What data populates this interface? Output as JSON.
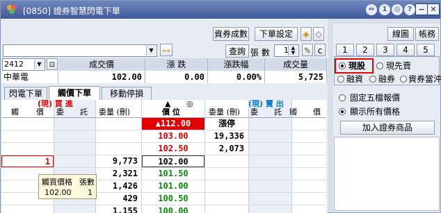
{
  "window": {
    "title": "[0850] 證券智慧閃電下單"
  },
  "titlebar_icons": [
    "nav-icon",
    "help-icon",
    "question-icon"
  ],
  "toolbar": {
    "btn_trade_result": "資券成數",
    "btn_order_setting": "下單設定",
    "btn_query": "查詢",
    "qty_label": "張 數",
    "qty_value": "1",
    "btn_chart": "線圖",
    "btn_account": "帳務",
    "num_buttons": [
      "1",
      "2",
      "3",
      "4",
      "5"
    ]
  },
  "stock": {
    "code": "2412",
    "name": "中華電",
    "headers": [
      "成交價",
      "漲 跌",
      "漲跌幅",
      "成交量"
    ],
    "values": [
      "102.00",
      "0.00",
      "0.00%",
      "5,725"
    ]
  },
  "tabs": [
    "閃電下單",
    "觸價下單",
    "移動停損"
  ],
  "grid": {
    "buy_title": "(現) 買 進",
    "sell_title": "(現) 賣 出",
    "mid_symbols": [
      "▲",
      "◎"
    ],
    "headers": {
      "left": [
        "觸",
        "價",
        "委",
        "託",
        "委量 (刪)"
      ],
      "mid": "價 位",
      "right": [
        "委量 (刪)",
        "委",
        "託",
        "觸",
        "價"
      ]
    },
    "rows": [
      {
        "trigger_buy": "",
        "buy_qty": "",
        "price": "▲112.00",
        "sell_qty": "漲停"
      },
      {
        "trigger_buy": "",
        "buy_qty": "",
        "price": "103.00",
        "sell_qty": "19,336"
      },
      {
        "trigger_buy": "",
        "buy_qty": "",
        "price": "102.50",
        "sell_qty": "2,073"
      },
      {
        "trigger_buy": "1",
        "buy_qty": "9,773",
        "price": "102.00",
        "sell_qty": ""
      },
      {
        "trigger_buy": "",
        "buy_qty": "2,321",
        "price": "101.50",
        "sell_qty": ""
      },
      {
        "trigger_buy": "",
        "buy_qty": "1,426",
        "price": "101.00",
        "sell_qty": ""
      },
      {
        "trigger_buy": "",
        "buy_qty": "429",
        "price": "100.50",
        "sell_qty": ""
      },
      {
        "trigger_buy": "",
        "buy_qty": "1,155",
        "price": "100.00",
        "sell_qty": ""
      }
    ]
  },
  "tooltip": {
    "label_price": "觸買價格",
    "label_qty": "張數",
    "price": "102.00",
    "qty": "1"
  },
  "right_panel": {
    "radio_cash": "現股",
    "radio_cash_first": "現先賣",
    "radio_margin": "融資",
    "radio_short": "融券",
    "radio_daytrade": "資券當沖",
    "radio_fixed5": "固定五檔報價",
    "radio_allprice": "顯示所有價格",
    "btn_add": "加入證券商品"
  },
  "colors": {
    "title_bg": "#3f5a9c",
    "price_up": "#d40000",
    "price_down": "#0a8a0a",
    "highlight": "#e00000"
  }
}
